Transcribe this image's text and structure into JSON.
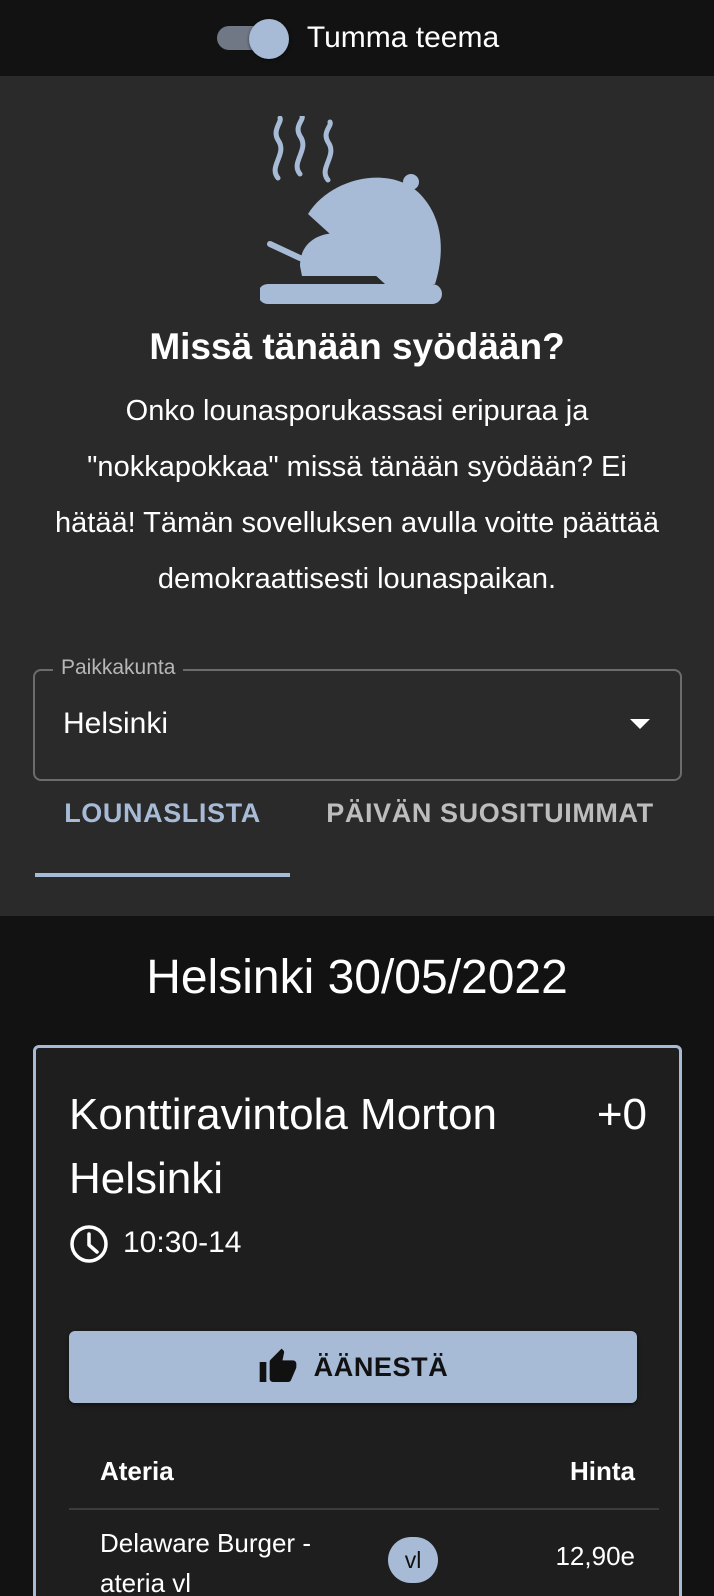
{
  "theme_toggle": {
    "label": "Tumma teema",
    "on": true
  },
  "hero": {
    "icon": "serving-dish-icon",
    "title": "Missä tänään syödään?",
    "description": "Onko lounasporukassasi eripuraa ja \"nokkapokkaa\" missä tänään syödään? Ei hätää! Tämän sovelluksen avulla voitte päättää demokraattisesti lounaspaikan."
  },
  "city_select": {
    "label": "Paikkakunta",
    "value": "Helsinki"
  },
  "tabs": [
    {
      "label": "LOUNASLISTA",
      "active": true
    },
    {
      "label": "PÄIVÄN SUOSITUIMMAT",
      "active": false
    }
  ],
  "date_heading": "Helsinki 30/05/2022",
  "restaurant": {
    "name": "Konttiravintola Morton Helsinki",
    "votes": "+0",
    "hours_icon": "clock-icon",
    "hours": "10:30-14",
    "vote_button": {
      "label": "ÄÄNESTÄ",
      "icon": "thumb-up-icon"
    },
    "menu_headers": {
      "meal": "Ateria",
      "price": "Hinta"
    },
    "meals": [
      {
        "name": "Delaware Burger -ateria vl",
        "tag": "vl",
        "price": "12,90e"
      }
    ]
  },
  "colors": {
    "accent": "#a7bbd6",
    "background": "#121212",
    "panel": "#2a2a2a",
    "card": "#1e1e1e"
  }
}
